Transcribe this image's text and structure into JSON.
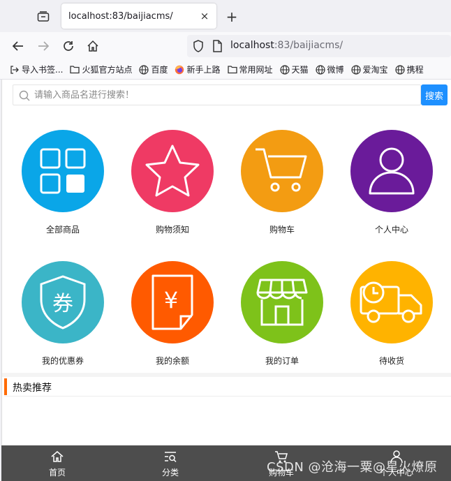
{
  "browser": {
    "tab_title": "localhost:83/baijiacms/",
    "close_glyph": "×",
    "new_tab_glyph": "+",
    "url_host": "localhost",
    "url_rest": ":83/baijiacms/",
    "bookmarks": [
      {
        "label": "导入书签...",
        "icon": "import-icon"
      },
      {
        "label": "火狐官方站点",
        "icon": "folder-icon"
      },
      {
        "label": "百度",
        "icon": "globe-icon"
      },
      {
        "label": "新手上路",
        "icon": "firefox-icon"
      },
      {
        "label": "常用网址",
        "icon": "folder-icon"
      },
      {
        "label": "天猫",
        "icon": "globe-icon"
      },
      {
        "label": "微博",
        "icon": "globe-icon"
      },
      {
        "label": "爱淘宝",
        "icon": "globe-icon"
      },
      {
        "label": "携程",
        "icon": "globe-icon"
      }
    ]
  },
  "search": {
    "placeholder": "请输入商品名进行搜索！",
    "button_label": "搜索"
  },
  "grid": [
    {
      "label": "全部商品",
      "icon": "grid-icon",
      "color": "#0aa6e8"
    },
    {
      "label": "购物须知",
      "icon": "star-icon",
      "color": "#ef3a64"
    },
    {
      "label": "购物车",
      "icon": "cart-icon",
      "color": "#f39c12"
    },
    {
      "label": "个人中心",
      "icon": "user-icon",
      "color": "#6a1b9a"
    },
    {
      "label": "我的优惠券",
      "icon": "coupon-icon",
      "color": "#3bb5c7"
    },
    {
      "label": "我的余额",
      "icon": "balance-icon",
      "color": "#ff5a00"
    },
    {
      "label": "我的订单",
      "icon": "shop-icon",
      "color": "#7ec21a"
    },
    {
      "label": "待收货",
      "icon": "truck-icon",
      "color": "#ffb300"
    }
  ],
  "hot": {
    "title": "热卖推荐",
    "accent": "#ff6a00"
  },
  "bottom_nav": [
    {
      "label": "首页",
      "icon": "home-icon"
    },
    {
      "label": "分类",
      "icon": "category-icon"
    },
    {
      "label": "购物车",
      "icon": "cart-icon"
    },
    {
      "label": "个人中心",
      "icon": "user-icon"
    }
  ],
  "watermark": "CSDN @沧海一粟@星火燎原"
}
